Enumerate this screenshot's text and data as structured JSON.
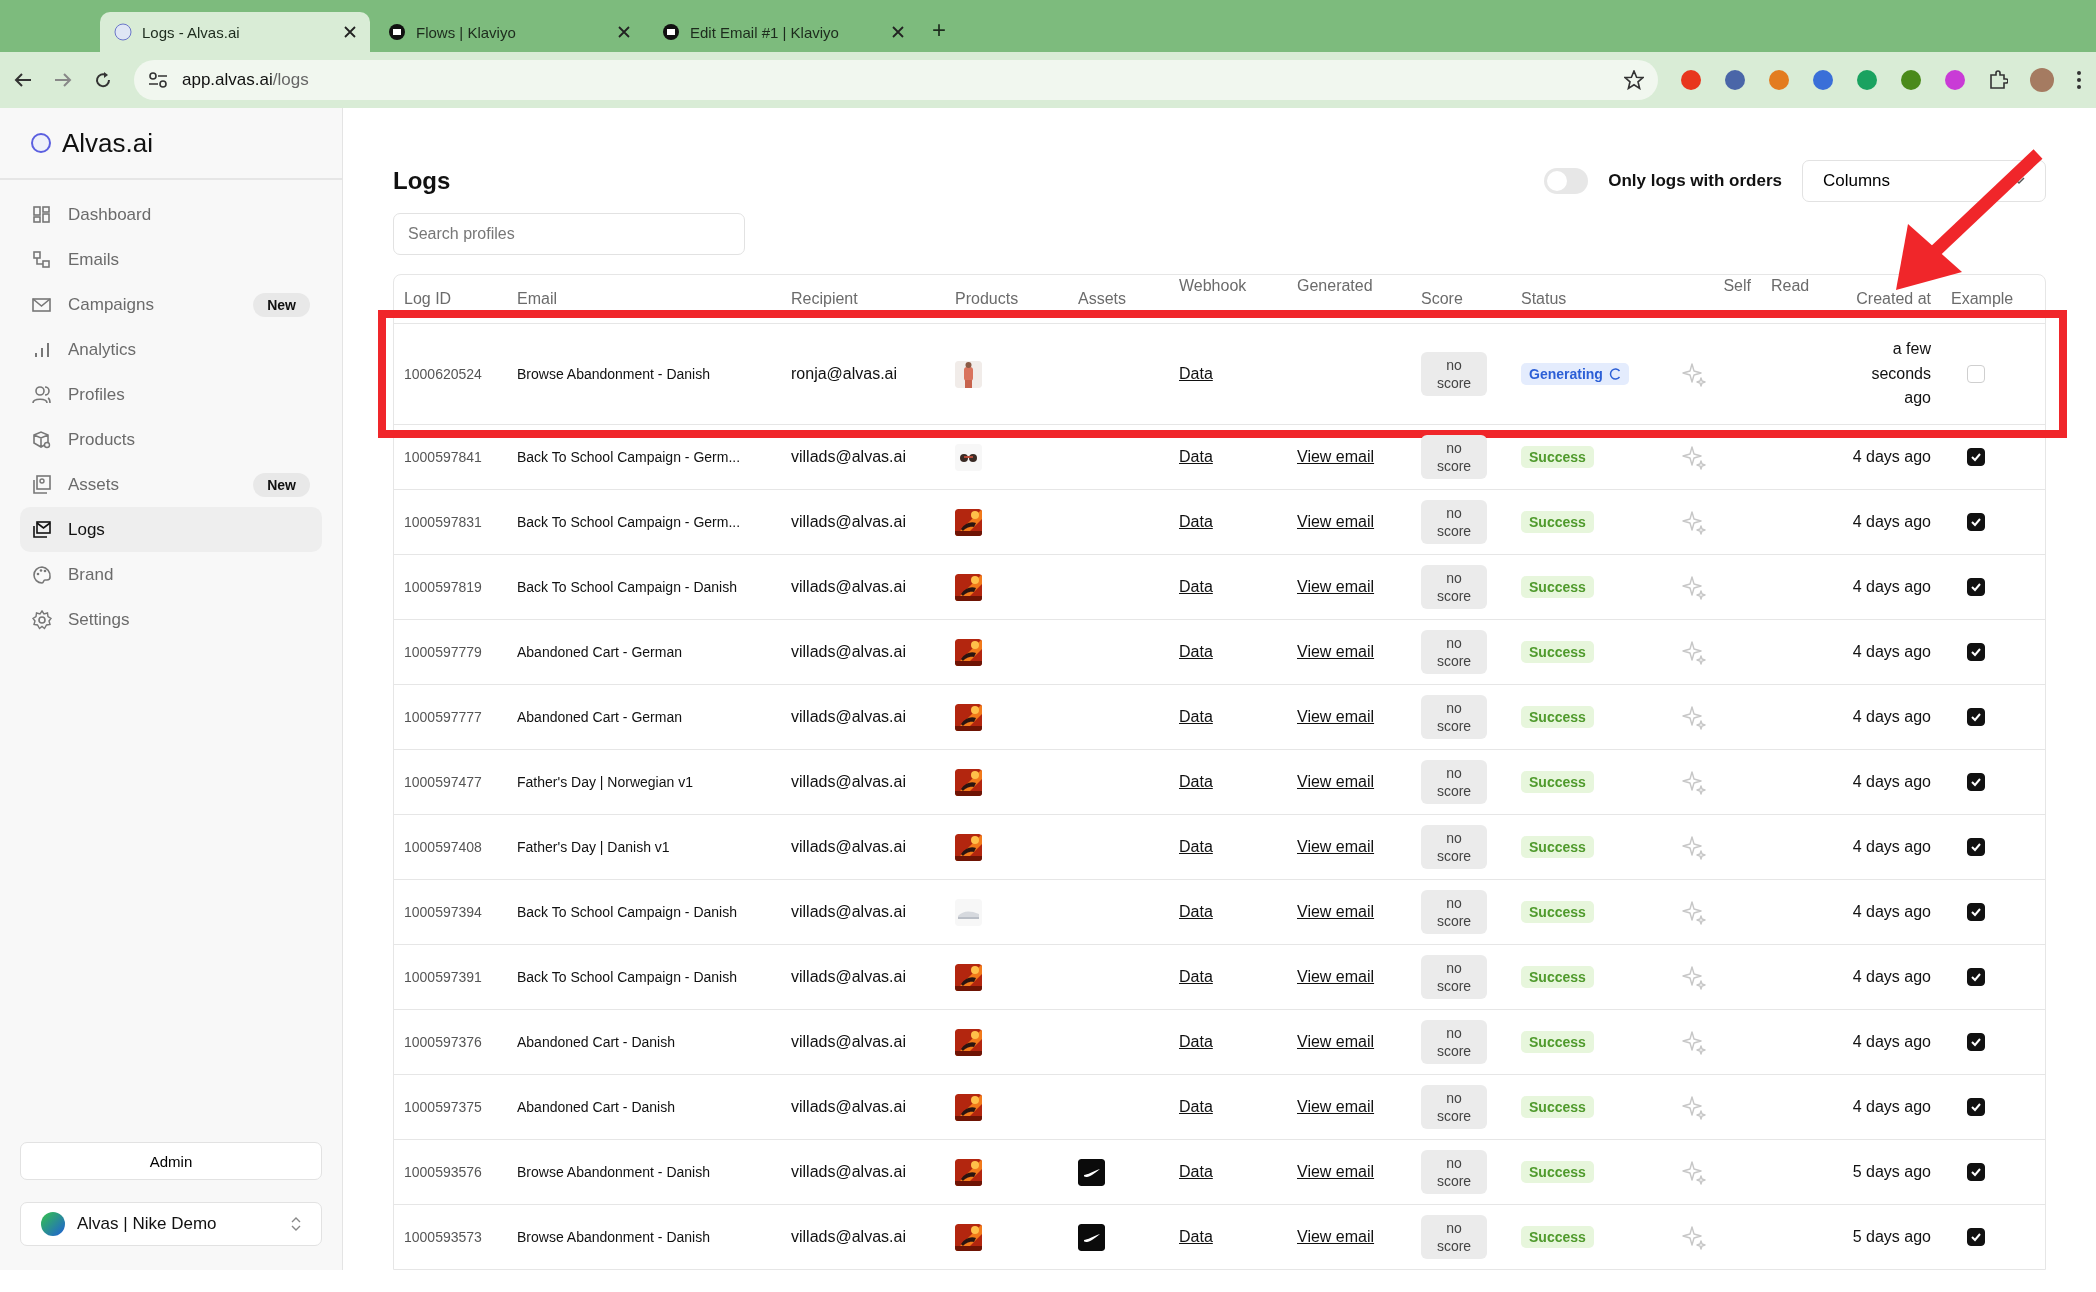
{
  "browser": {
    "tabs": [
      {
        "title": "Logs - Alvas.ai",
        "selected": true,
        "kind": "alvas"
      },
      {
        "title": "Flows | Klaviyo",
        "selected": false,
        "kind": "klaviyo"
      },
      {
        "title": "Edit Email #1 | Klaviyo",
        "selected": false,
        "kind": "klaviyo"
      }
    ],
    "new_tab": "+",
    "address": {
      "host": "app.alvas.ai",
      "path": "/logs"
    }
  },
  "sidebar": {
    "logo": "Alvas.ai",
    "items": [
      {
        "label": "Dashboard",
        "selected": false
      },
      {
        "label": "Emails",
        "selected": false
      },
      {
        "label": "Campaigns",
        "selected": false,
        "badge": "New"
      },
      {
        "label": "Analytics",
        "selected": false
      },
      {
        "label": "Profiles",
        "selected": false
      },
      {
        "label": "Products",
        "selected": false
      },
      {
        "label": "Assets",
        "selected": false,
        "badge": "New"
      },
      {
        "label": "Logs",
        "selected": true
      },
      {
        "label": "Brand",
        "selected": false
      },
      {
        "label": "Settings",
        "selected": false
      }
    ],
    "admin_button": "Admin",
    "workspace": "Alvas | Nike Demo"
  },
  "page": {
    "title": "Logs",
    "toggle": {
      "label": "Only logs with orders",
      "on": false
    },
    "columns_button": "Columns",
    "search": {
      "placeholder": "Search profiles"
    }
  },
  "table": {
    "columns": [
      "Log ID",
      "Email",
      "Recipient",
      "Products",
      "Assets",
      "Webhook",
      "Generated",
      "Score",
      "Status",
      "Self",
      "Read",
      "Created at",
      "Example"
    ],
    "rows": [
      {
        "log_id": "1000620524",
        "email": "Browse Abandonment - Danish",
        "recipient": "ronja@alvas.ai",
        "webhook": "Data",
        "score": "no score",
        "status": {
          "label": "Generating",
          "kind": "generating"
        },
        "created": "a few seconds ago",
        "example": false,
        "highlighted": true
      },
      {
        "log_id": "1000597841",
        "email": "Back To School Campaign - Germ...",
        "recipient": "villads@alvas.ai",
        "webhook": "Data",
        "generated": "View email",
        "score": "no score",
        "status": {
          "label": "Success",
          "kind": "success"
        },
        "created": "4 days ago",
        "example": true,
        "highlighted": false
      },
      {
        "log_id": "1000597831",
        "email": "Back To School Campaign - Germ...",
        "recipient": "villads@alvas.ai",
        "webhook": "Data",
        "generated": "View email",
        "score": "no score",
        "status": {
          "label": "Success",
          "kind": "success"
        },
        "created": "4 days ago",
        "example": true,
        "highlighted": false
      },
      {
        "log_id": "1000597819",
        "email": "Back To School Campaign - Danish",
        "recipient": "villads@alvas.ai",
        "webhook": "Data",
        "generated": "View email",
        "score": "no score",
        "status": {
          "label": "Success",
          "kind": "success"
        },
        "created": "4 days ago",
        "example": true,
        "highlighted": false
      },
      {
        "log_id": "1000597779",
        "email": "Abandoned Cart - German",
        "recipient": "villads@alvas.ai",
        "webhook": "Data",
        "generated": "View email",
        "score": "no score",
        "status": {
          "label": "Success",
          "kind": "success"
        },
        "created": "4 days ago",
        "example": true,
        "highlighted": false
      },
      {
        "log_id": "1000597777",
        "email": "Abandoned Cart - German",
        "recipient": "villads@alvas.ai",
        "webhook": "Data",
        "generated": "View email",
        "score": "no score",
        "status": {
          "label": "Success",
          "kind": "success"
        },
        "created": "4 days ago",
        "example": true,
        "highlighted": false
      },
      {
        "log_id": "1000597477",
        "email": "Father's Day | Norwegian v1",
        "recipient": "villads@alvas.ai",
        "webhook": "Data",
        "generated": "View email",
        "score": "no score",
        "status": {
          "label": "Success",
          "kind": "success"
        },
        "created": "4 days ago",
        "example": true,
        "highlighted": false
      },
      {
        "log_id": "1000597408",
        "email": "Father's Day | Danish v1",
        "recipient": "villads@alvas.ai",
        "webhook": "Data",
        "generated": "View email",
        "score": "no score",
        "status": {
          "label": "Success",
          "kind": "success"
        },
        "created": "4 days ago",
        "example": true,
        "highlighted": false
      },
      {
        "log_id": "1000597394",
        "email": "Back To School Campaign - Danish",
        "recipient": "villads@alvas.ai",
        "webhook": "Data",
        "generated": "View email",
        "score": "no score",
        "status": {
          "label": "Success",
          "kind": "success"
        },
        "created": "4 days ago",
        "example": true,
        "highlighted": false
      },
      {
        "log_id": "1000597391",
        "email": "Back To School Campaign - Danish",
        "recipient": "villads@alvas.ai",
        "webhook": "Data",
        "generated": "View email",
        "score": "no score",
        "status": {
          "label": "Success",
          "kind": "success"
        },
        "created": "4 days ago",
        "example": true,
        "highlighted": false
      },
      {
        "log_id": "1000597376",
        "email": "Abandoned Cart - Danish",
        "recipient": "villads@alvas.ai",
        "webhook": "Data",
        "generated": "View email",
        "score": "no score",
        "status": {
          "label": "Success",
          "kind": "success"
        },
        "created": "4 days ago",
        "example": true,
        "highlighted": false
      },
      {
        "log_id": "1000597375",
        "email": "Abandoned Cart - Danish",
        "recipient": "villads@alvas.ai",
        "webhook": "Data",
        "generated": "View email",
        "score": "no score",
        "status": {
          "label": "Success",
          "kind": "success"
        },
        "created": "4 days ago",
        "example": true,
        "highlighted": false
      },
      {
        "log_id": "1000593576",
        "email": "Browse Abandonment - Danish",
        "recipient": "villads@alvas.ai",
        "webhook": "Data",
        "generated": "View email",
        "score": "no score",
        "status": {
          "label": "Success",
          "kind": "success"
        },
        "created": "5 days ago",
        "example": true,
        "highlighted": false
      },
      {
        "log_id": "1000593573",
        "email": "Browse Abandonment - Danish",
        "recipient": "villads@alvas.ai",
        "webhook": "Data",
        "generated": "View email",
        "score": "no score",
        "status": {
          "label": "Success",
          "kind": "success"
        },
        "created": "5 days ago",
        "example": true,
        "highlighted": false
      }
    ]
  }
}
